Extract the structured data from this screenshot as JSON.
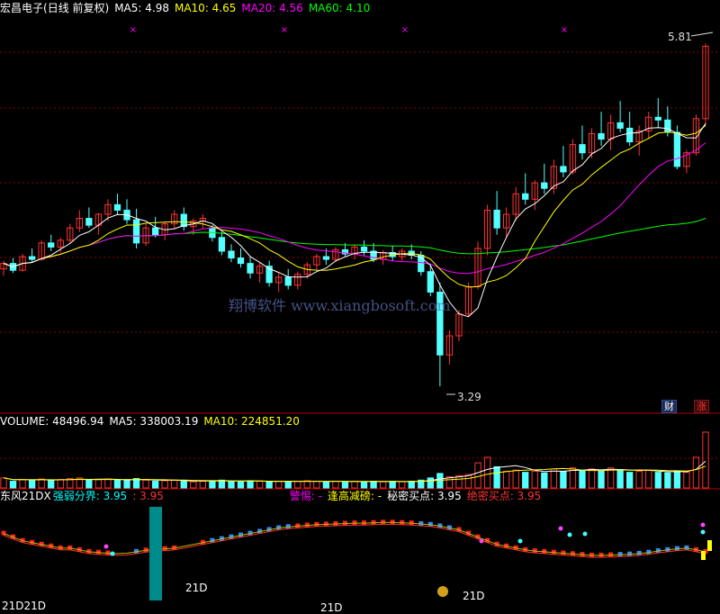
{
  "header": {
    "stock_name": "宏昌电子",
    "period": "(日线 前复权)",
    "ma5": "MA5: 4.98",
    "ma10": "MA10: 4.65",
    "ma20": "MA20: 4.56",
    "ma60": "MA60: 4.10"
  },
  "price_panel": {
    "high_label": "5.81",
    "low_label": "3.29",
    "watermark": "翔博软件 www.xiangbosoft.com",
    "badge_cai": "财",
    "badge_zhang": "涨"
  },
  "volume_panel": {
    "volume": "VOLUME: 48496.94",
    "ma5": "MA5: 338003.19",
    "ma10": "MA10: 224851.20"
  },
  "indicator_panel": {
    "name": "东风21DX",
    "strength_label": "强弱分界: 3.95",
    "strength_value": ": 3.95",
    "warning": "警惕: -",
    "high_reduce": "逢高减磅: -",
    "secret_buy": "秘密买点: 3.95",
    "absolute_buy": "绝密买点: 3.95",
    "tag_a": "21D21D",
    "tag_b": "21D",
    "tag_c": "21D",
    "tag_d": "21D"
  },
  "colors": {
    "up": "#ff3232",
    "down": "#54ffff",
    "ma5": "#ffffff",
    "ma10": "#ffff00",
    "ma20": "#ff00ff",
    "ma60": "#00ff00",
    "grid": "#8b0000",
    "frame": "#b00000"
  },
  "chart_data": {
    "type": "candlestick",
    "title": "宏昌电子 (日线 前复权)",
    "ylim": [
      3.1,
      6.0
    ],
    "high": 5.81,
    "low": 3.29,
    "candles": [
      [
        4.15,
        4.21,
        4.1,
        4.19
      ],
      [
        4.19,
        4.23,
        4.12,
        4.14
      ],
      [
        4.14,
        4.26,
        4.13,
        4.24
      ],
      [
        4.24,
        4.3,
        4.2,
        4.22
      ],
      [
        4.22,
        4.36,
        4.21,
        4.34
      ],
      [
        4.34,
        4.4,
        4.28,
        4.31
      ],
      [
        4.31,
        4.38,
        4.27,
        4.36
      ],
      [
        4.36,
        4.48,
        4.34,
        4.45
      ],
      [
        4.45,
        4.58,
        4.42,
        4.52
      ],
      [
        4.52,
        4.6,
        4.45,
        4.47
      ],
      [
        4.47,
        4.56,
        4.4,
        4.55
      ],
      [
        4.55,
        4.66,
        4.5,
        4.62
      ],
      [
        4.62,
        4.7,
        4.55,
        4.58
      ],
      [
        4.58,
        4.66,
        4.48,
        4.51
      ],
      [
        4.51,
        4.59,
        4.3,
        4.34
      ],
      [
        4.34,
        4.48,
        4.32,
        4.45
      ],
      [
        4.45,
        4.53,
        4.38,
        4.4
      ],
      [
        4.4,
        4.5,
        4.36,
        4.48
      ],
      [
        4.48,
        4.58,
        4.44,
        4.55
      ],
      [
        4.55,
        4.6,
        4.43,
        4.46
      ],
      [
        4.46,
        4.52,
        4.4,
        4.5
      ],
      [
        4.5,
        4.55,
        4.44,
        4.52
      ],
      [
        4.45,
        4.47,
        4.35,
        4.38
      ],
      [
        4.38,
        4.42,
        4.25,
        4.28
      ],
      [
        4.28,
        4.33,
        4.2,
        4.23
      ],
      [
        4.23,
        4.3,
        4.16,
        4.19
      ],
      [
        4.19,
        4.24,
        4.08,
        4.12
      ],
      [
        4.12,
        4.2,
        4.05,
        4.17
      ],
      [
        4.17,
        4.21,
        4.02,
        4.05
      ],
      [
        4.05,
        4.12,
        3.98,
        4.09
      ],
      [
        4.09,
        4.15,
        4.0,
        4.03
      ],
      [
        4.03,
        4.13,
        4.0,
        4.11
      ],
      [
        4.11,
        4.2,
        4.08,
        4.18
      ],
      [
        4.18,
        4.26,
        4.14,
        4.24
      ],
      [
        4.24,
        4.3,
        4.18,
        4.22
      ],
      [
        4.22,
        4.31,
        4.2,
        4.29
      ],
      [
        4.29,
        4.34,
        4.24,
        4.26
      ],
      [
        4.26,
        4.33,
        4.22,
        4.31
      ],
      [
        4.31,
        4.36,
        4.25,
        4.28
      ],
      [
        4.28,
        4.34,
        4.2,
        4.22
      ],
      [
        4.22,
        4.29,
        4.18,
        4.27
      ],
      [
        4.27,
        4.32,
        4.21,
        4.24
      ],
      [
        4.24,
        4.3,
        4.2,
        4.28
      ],
      [
        4.28,
        4.33,
        4.22,
        4.25
      ],
      [
        4.25,
        4.28,
        4.1,
        4.13
      ],
      [
        4.13,
        4.18,
        3.95,
        3.98
      ],
      [
        3.98,
        4.05,
        3.29,
        3.52
      ],
      [
        3.52,
        3.7,
        3.45,
        3.66
      ],
      [
        3.66,
        3.85,
        3.62,
        3.82
      ],
      [
        3.82,
        4.05,
        3.8,
        4.02
      ],
      [
        4.02,
        4.35,
        4.0,
        4.3
      ],
      [
        4.3,
        4.62,
        4.25,
        4.58
      ],
      [
        4.58,
        4.72,
        4.4,
        4.45
      ],
      [
        4.45,
        4.6,
        4.38,
        4.55
      ],
      [
        4.55,
        4.75,
        4.5,
        4.7
      ],
      [
        4.7,
        4.85,
        4.62,
        4.66
      ],
      [
        4.66,
        4.8,
        4.58,
        4.78
      ],
      [
        4.78,
        4.92,
        4.7,
        4.74
      ],
      [
        4.74,
        4.95,
        4.7,
        4.9
      ],
      [
        4.9,
        5.05,
        4.82,
        4.86
      ],
      [
        4.86,
        5.1,
        4.84,
        5.06
      ],
      [
        5.06,
        5.2,
        4.95,
        5.0
      ],
      [
        5.0,
        5.18,
        4.96,
        5.14
      ],
      [
        5.14,
        5.3,
        5.05,
        5.1
      ],
      [
        5.1,
        5.28,
        5.02,
        5.22
      ],
      [
        5.22,
        5.38,
        5.15,
        5.18
      ],
      [
        5.18,
        5.3,
        5.05,
        5.08
      ],
      [
        5.08,
        5.2,
        4.98,
        5.16
      ],
      [
        5.16,
        5.3,
        5.1,
        5.26
      ],
      [
        5.26,
        5.4,
        5.18,
        5.24
      ],
      [
        5.24,
        5.34,
        5.12,
        5.15
      ],
      [
        5.15,
        5.2,
        4.88,
        4.9
      ],
      [
        4.9,
        5.02,
        4.85,
        5.0
      ],
      [
        5.0,
        5.28,
        4.98,
        5.25
      ],
      [
        5.25,
        5.8,
        5.2,
        5.78
      ]
    ],
    "volume": [
      0.18,
      0.12,
      0.15,
      0.14,
      0.16,
      0.13,
      0.15,
      0.17,
      0.18,
      0.14,
      0.15,
      0.16,
      0.14,
      0.13,
      0.17,
      0.14,
      0.12,
      0.13,
      0.14,
      0.12,
      0.11,
      0.12,
      0.13,
      0.14,
      0.12,
      0.11,
      0.13,
      0.12,
      0.11,
      0.12,
      0.11,
      0.12,
      0.13,
      0.12,
      0.11,
      0.12,
      0.11,
      0.12,
      0.11,
      0.12,
      0.11,
      0.12,
      0.11,
      0.12,
      0.14,
      0.18,
      0.26,
      0.2,
      0.22,
      0.24,
      0.45,
      0.55,
      0.38,
      0.3,
      0.32,
      0.28,
      0.3,
      0.27,
      0.34,
      0.3,
      0.36,
      0.32,
      0.34,
      0.3,
      0.36,
      0.33,
      0.28,
      0.3,
      0.32,
      0.28,
      0.27,
      0.3,
      0.28,
      0.55,
      1.0
    ],
    "indicator": {
      "strength_line": [
        2.2,
        2.1,
        2.0,
        1.95,
        1.9,
        1.85,
        1.8,
        1.8,
        1.75,
        1.7,
        1.68,
        1.66,
        1.65,
        1.66,
        1.7,
        1.74,
        1.76,
        1.78,
        1.8,
        1.85,
        1.9,
        1.95,
        2.0,
        2.05,
        2.1,
        2.15,
        2.2,
        2.25,
        2.3,
        2.35,
        2.38,
        2.4,
        2.42,
        2.44,
        2.45,
        2.46,
        2.47,
        2.48,
        2.48,
        2.49,
        2.5,
        2.5,
        2.49,
        2.48,
        2.46,
        2.44,
        2.4,
        2.35,
        2.3,
        2.2,
        2.1,
        2.0,
        1.9,
        1.85,
        1.8,
        1.75,
        1.72,
        1.7,
        1.68,
        1.66,
        1.64,
        1.62,
        1.6,
        1.6,
        1.61,
        1.62,
        1.63,
        1.65,
        1.68,
        1.72,
        1.75,
        1.78,
        1.8,
        1.75,
        1.7
      ],
      "columns": [
        1,
        1,
        1,
        1,
        1,
        1,
        1,
        1,
        1,
        1,
        1,
        1,
        0,
        0,
        -1,
        1,
        1,
        1,
        1,
        0,
        0,
        1,
        -1,
        -1,
        -1,
        -1,
        -1,
        -1,
        -1,
        -1,
        -1,
        1,
        1,
        1,
        1,
        1,
        1,
        1,
        1,
        1,
        1,
        1,
        1,
        1,
        -1,
        -1,
        -1,
        -1,
        1,
        1,
        1,
        1,
        1,
        1,
        1,
        1,
        1,
        1,
        1,
        1,
        1,
        1,
        1,
        1,
        1,
        -1,
        -1,
        -1,
        -1,
        -1,
        -1,
        -1,
        -1,
        1,
        1
      ]
    }
  }
}
